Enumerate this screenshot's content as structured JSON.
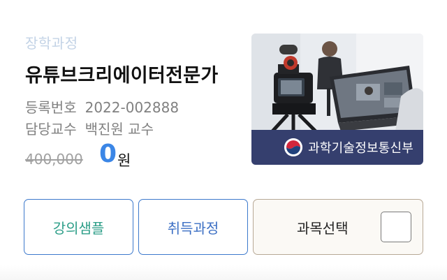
{
  "course": {
    "category": "장학과정",
    "title": "유튜브크리에이터전문가",
    "registration_label": "등록번호",
    "registration_number": "2022-002888",
    "professor_label": "담당교수",
    "professor_name": "백진원 교수",
    "original_price": "400,000",
    "sale_price": "0",
    "price_unit": "원"
  },
  "thumbnail": {
    "ministry_label": "과학기술정보통신부",
    "emblem_icon": "korea-government-emblem-icon"
  },
  "actions": {
    "sample_label": "강의샘플",
    "acquire_label": "취득과정",
    "select_label": "과목선택"
  },
  "colors": {
    "accent_blue": "#3b86e6",
    "ministry_bar": "#353f6e",
    "sample_text": "#2d9e88",
    "category_text": "#c3d3e6"
  }
}
